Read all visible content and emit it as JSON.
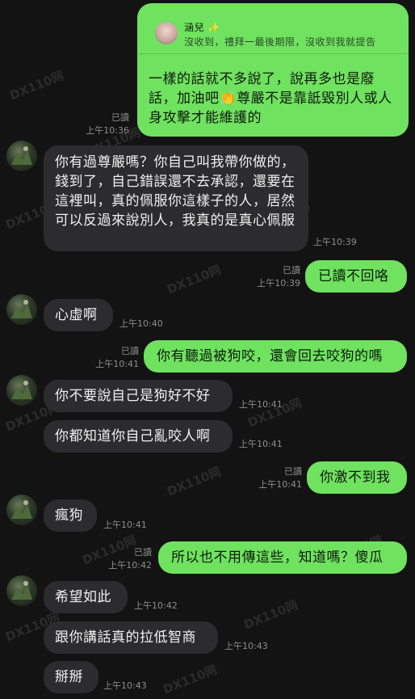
{
  "quoted": {
    "name": "涵兒 ✨",
    "text": "沒收到，禮拜一最後期限，沒收到我就提告"
  },
  "messages": [
    {
      "id": "m1",
      "text": "一樣的話就不多說了，說再多也是廢話，加油吧👏尊嚴不是靠詆毀別人或人身攻擊才能維護的",
      "read": "已讀",
      "time": "上午10:36"
    },
    {
      "id": "m2",
      "text": "你有過尊嚴嗎？你自己叫我帶你做的，錢到了，自己錯誤還不去承認，還要在這裡叫，真的佩服你這樣子的人，居然可以反過來說別人，我真的是真心佩服",
      "time": "上午10:39"
    },
    {
      "id": "m3",
      "text": "已讀不回咯",
      "read": "已讀",
      "time": "上午10:39"
    },
    {
      "id": "m4",
      "text": "心虛啊",
      "time": "上午10:40"
    },
    {
      "id": "m5",
      "text": "你有聽過被狗咬，還會回去咬狗的嗎",
      "read": "已讀",
      "time": "上午10:41"
    },
    {
      "id": "m6",
      "text": "你不要說自己是狗好不好",
      "time": "上午10:41"
    },
    {
      "id": "m7",
      "text": "你都知道你自己亂咬人啊",
      "time": "上午10:41"
    },
    {
      "id": "m8",
      "text": "你激不到我",
      "read": "已讀",
      "time": "上午10:41"
    },
    {
      "id": "m9",
      "text": "瘋狗",
      "time": "上午10:41"
    },
    {
      "id": "m10",
      "text": "所以也不用傳這些，知道嗎？傻瓜",
      "read": "已讀",
      "time": "上午10:42"
    },
    {
      "id": "m11",
      "text": "希望如此",
      "time": "上午10:42"
    },
    {
      "id": "m12",
      "text": "跟你講話真的拉低智商",
      "time": "上午10:43"
    },
    {
      "id": "m13",
      "text": "掰掰",
      "time": "上午10:43"
    }
  ],
  "watermark": "DX110网",
  "colors": {
    "outgoing": "#6fe25f",
    "incoming": "#2c2c2e",
    "background": "#131313"
  }
}
